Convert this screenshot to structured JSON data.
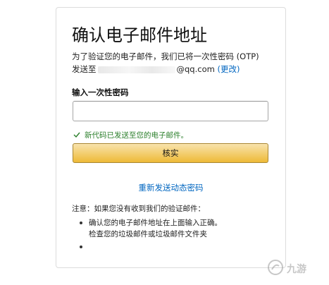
{
  "page": {
    "title": "确认电子邮件地址",
    "description_line1": "为了验证您的电子邮件，我们已将一次性密码 (OTP)",
    "description_send_to": "发送至",
    "email_suffix": "@qq.com",
    "change_link": "(更改)",
    "otp_label": "输入一次性密码",
    "otp_value": "",
    "success_message": "新代码已发送至您的电子邮件。",
    "verify_button": "核实",
    "resend_link": "重新发送动态密码",
    "note_title": "注意：如果您没有收到我们的验证邮件：",
    "note_items": [
      "确认您的电子邮件地址在上面输入正确。",
      "检查您的垃圾邮件或垃圾邮件文件夹",
      ""
    ],
    "watermark_text": "九游"
  },
  "colors": {
    "link": "#0066c0",
    "success": "#2b7f2b",
    "button_gradient_top": "#f8e3ad",
    "button_gradient_bottom": "#eeba37"
  }
}
